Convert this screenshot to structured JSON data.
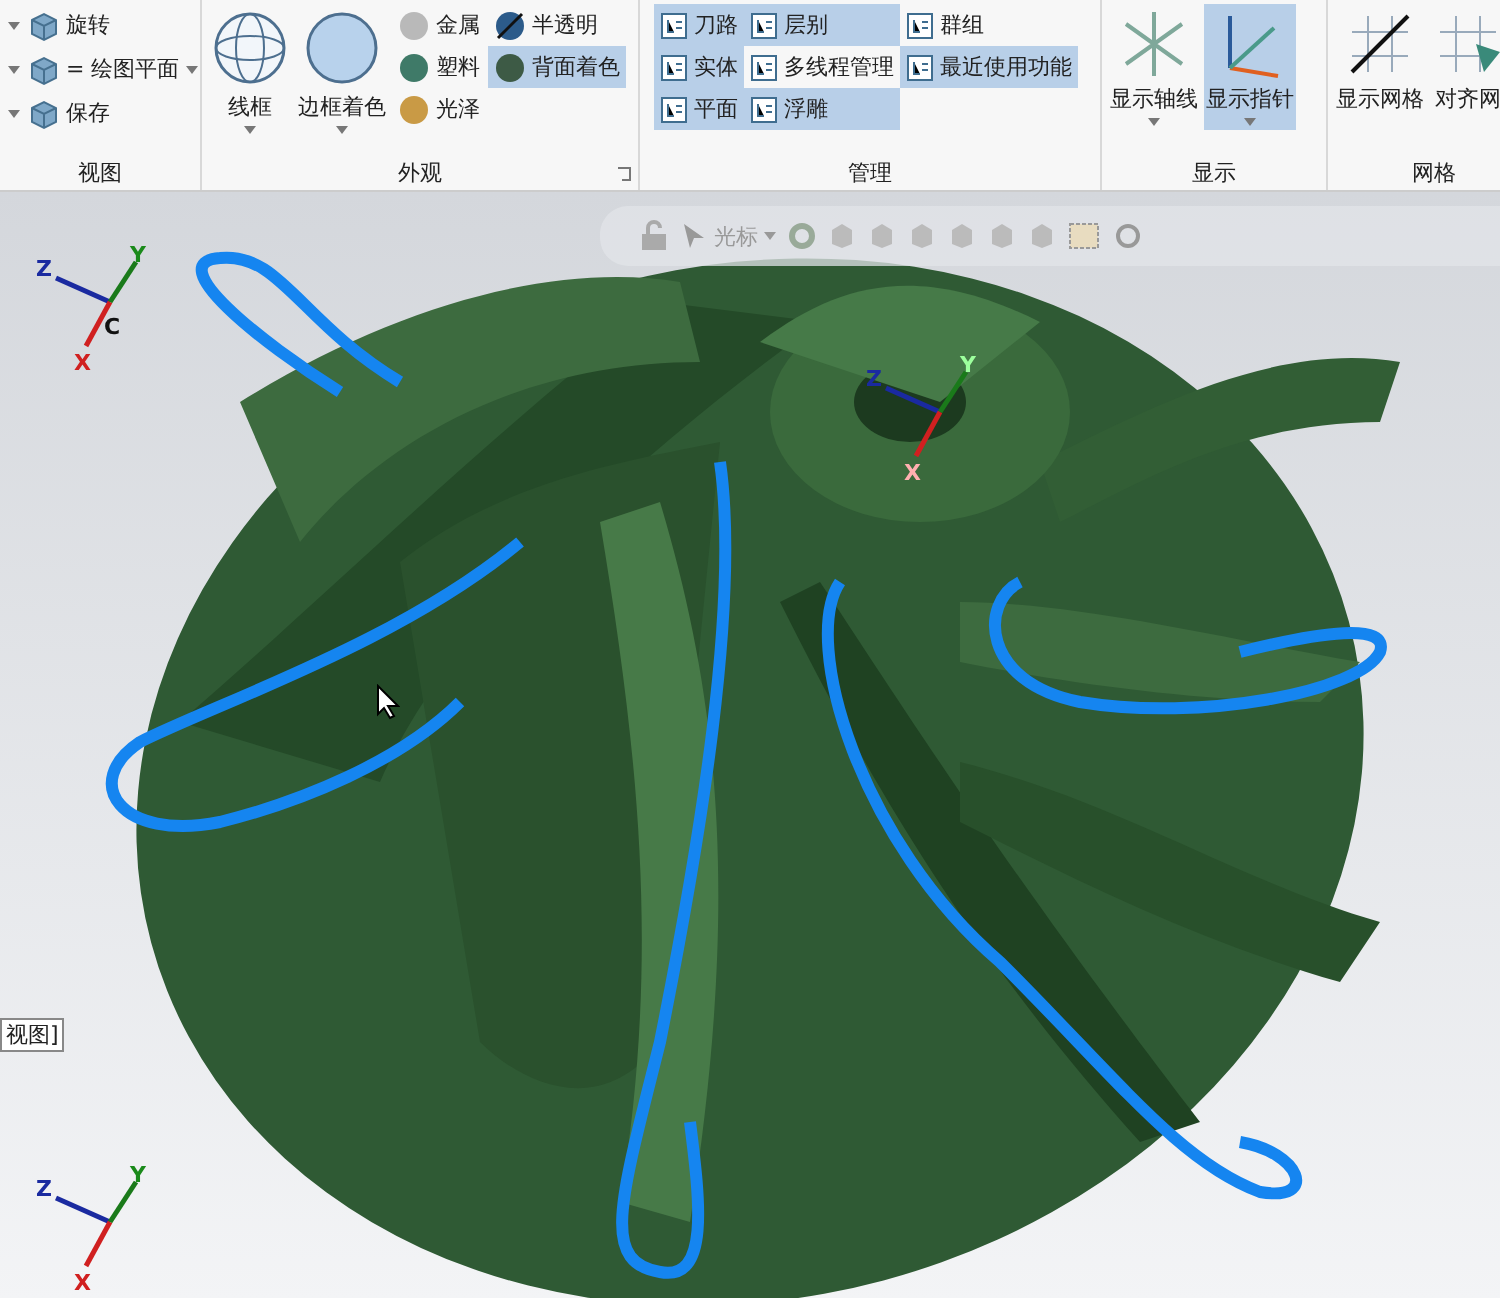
{
  "ribbon": {
    "groups": [
      {
        "kind": "view",
        "title": "视图",
        "items": [
          {
            "label": "旋转",
            "dropdown": false
          },
          {
            "label": "= 绘图平面",
            "dropdown": true
          },
          {
            "label": "保存",
            "dropdown": false
          }
        ]
      },
      {
        "kind": "appearance",
        "title": "外观",
        "large": [
          {
            "label": "线框"
          },
          {
            "label": "边框着色"
          }
        ],
        "small": [
          {
            "label": "金属",
            "selected": false
          },
          {
            "label": "半透明",
            "selected": false
          },
          {
            "label": "塑料",
            "selected": false
          },
          {
            "label": "背面着色",
            "selected": true
          },
          {
            "label": "光泽",
            "selected": false
          }
        ]
      },
      {
        "kind": "manage",
        "title": "管理",
        "items": [
          {
            "label": "刀路",
            "selected": true
          },
          {
            "label": "层别",
            "selected": true
          },
          {
            "label": "群组",
            "selected": false
          },
          {
            "label": "实体",
            "selected": true
          },
          {
            "label": "多线程管理",
            "selected": false
          },
          {
            "label": "最近使用功能",
            "selected": true
          },
          {
            "label": "平面",
            "selected": true
          },
          {
            "label": "浮雕",
            "selected": true
          }
        ]
      },
      {
        "kind": "display",
        "title": "显示",
        "items": [
          {
            "label": "显示轴线",
            "selected": false
          },
          {
            "label": "显示指针",
            "selected": true
          }
        ]
      },
      {
        "kind": "grid",
        "title": "网格",
        "items": [
          {
            "label": "显示网格"
          },
          {
            "label": "对齐网"
          }
        ]
      }
    ]
  },
  "viewport": {
    "toolbar": {
      "label": "光标"
    },
    "view_label": "视图]",
    "triads": [
      {
        "z": "Z",
        "y": "Y",
        "x": "X",
        "origin": "C"
      },
      {
        "z": "Z",
        "y": "Y",
        "x": "X"
      },
      {
        "z": "Z",
        "y": "Y",
        "x": "X"
      }
    ]
  }
}
